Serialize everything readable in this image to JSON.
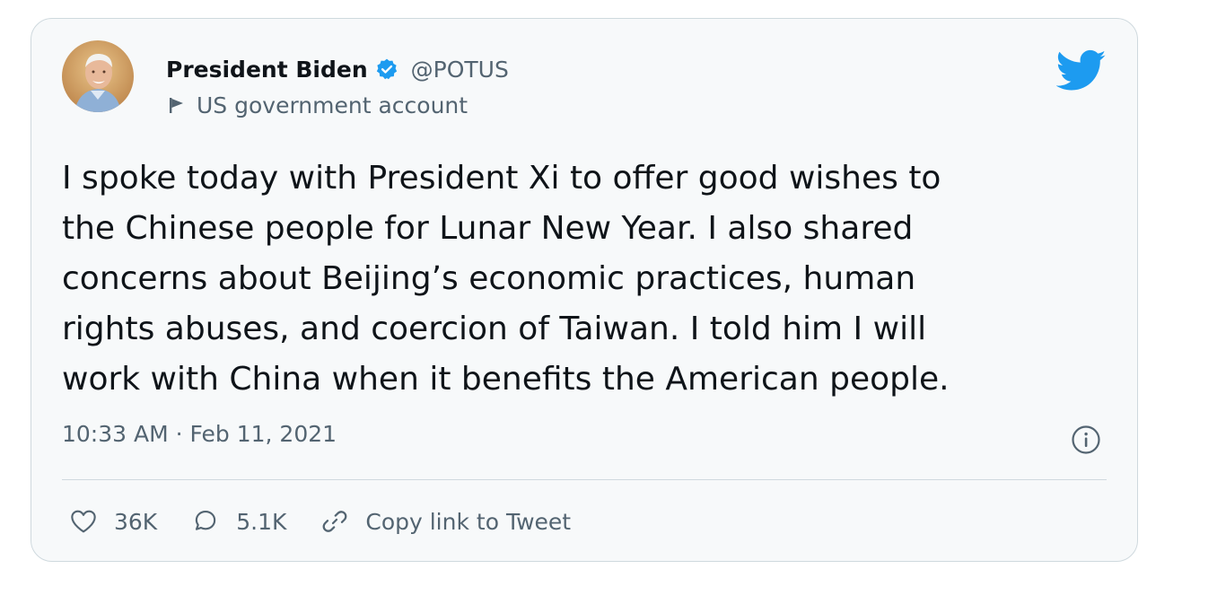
{
  "author": {
    "display_name": "President Biden",
    "handle": "@POTUS",
    "account_label": "US government account",
    "verified": true
  },
  "tweet": {
    "text": "I spoke today with President Xi to offer good wishes to\nthe Chinese people for Lunar New Year. I also shared\nconcerns about Beijing’s economic practices, human\nrights abuses, and coercion of Taiwan. I told him I will\nwork with China when it benefits the American people.",
    "timestamp": "10:33 AM · Feb 11, 2021"
  },
  "actions": {
    "like_count": "36K",
    "reply_count": "5.1K",
    "copy_link_label": "Copy link to Tweet"
  },
  "icons": {
    "brand": "twitter-bird-icon",
    "verified": "verified-badge-icon",
    "flag": "flag-icon",
    "info": "info-icon",
    "like": "heart-icon",
    "reply": "speech-bubble-icon",
    "link": "link-icon"
  },
  "colors": {
    "brand_blue": "#1d9bf0",
    "text_primary": "#0f1419",
    "text_secondary": "#536471",
    "border": "#cfd9de",
    "card_background": "#f7f9fa"
  }
}
